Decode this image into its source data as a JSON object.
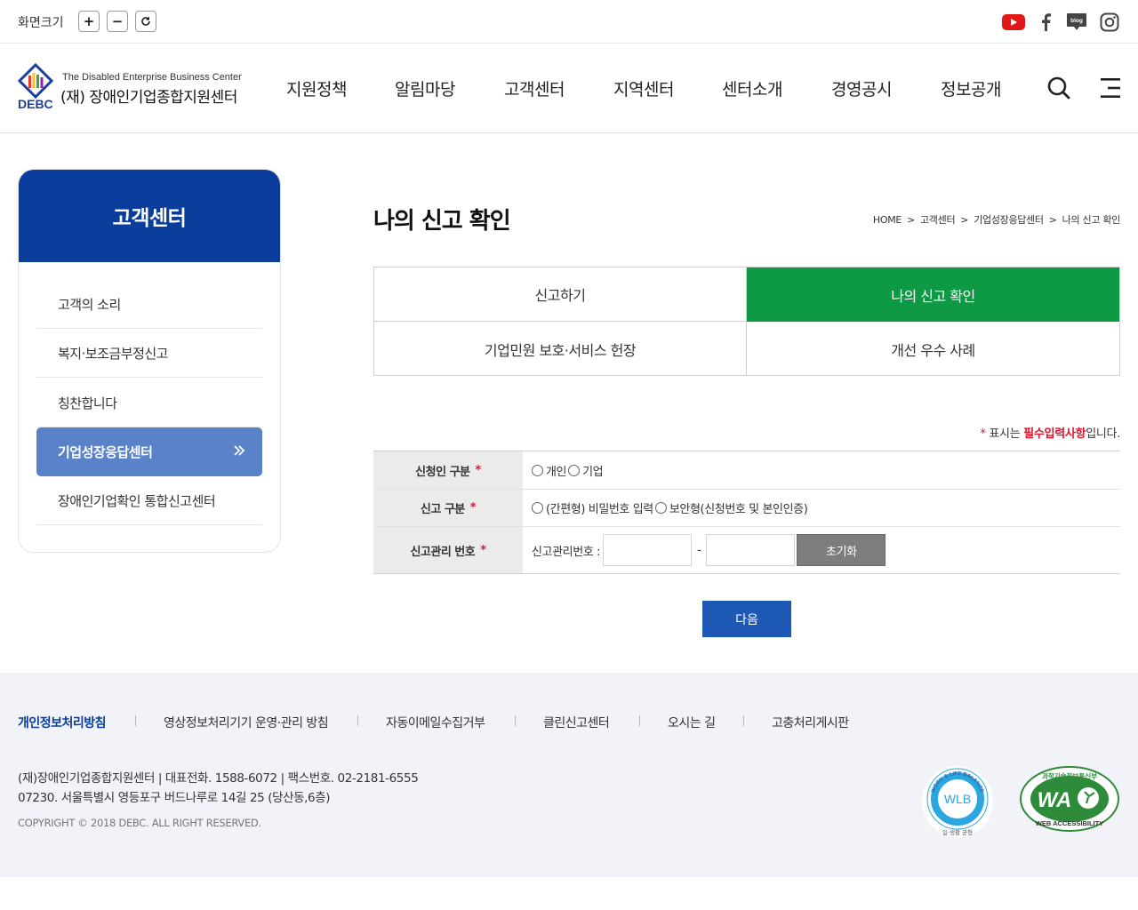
{
  "utility": {
    "screen_size_label": "화면크기",
    "zoom_in": "+",
    "zoom_out": "−",
    "reset_icon": "refresh-icon",
    "social_icons": [
      "youtube-icon",
      "facebook-icon",
      "blog-icon",
      "instagram-icon"
    ]
  },
  "header": {
    "logo_en": "The Disabled Enterprise Business Center",
    "logo_ko": "(재) 장애인기업종합지원센터",
    "logo_abbr": "DEBC",
    "nav": [
      "지원정책",
      "알림마당",
      "고객센터",
      "지역센터",
      "센터소개",
      "경영공시",
      "정보공개"
    ],
    "search_icon": "search-icon",
    "menu_icon": "menu-icon"
  },
  "sidebar": {
    "title": "고객센터",
    "items": [
      "고객의 소리",
      "복지·보조금부정신고",
      "칭찬합니다",
      "기업성장응답센터",
      "장애인기업확인 통합신고센터"
    ],
    "active_index": 3
  },
  "main": {
    "title": "나의 신고 확인",
    "breadcrumb": [
      "HOME",
      "고객센터",
      "기업성장응답센터",
      "나의 신고 확인"
    ],
    "breadcrumb_sep": ">",
    "tabs": [
      "신고하기",
      "나의 신고 확인",
      "기업민원 보호·서비스 헌장",
      "개선 우수 사례"
    ],
    "active_tab": 1,
    "required_note": {
      "star": "*",
      "prefix": " 표시는 ",
      "strong": "필수입력사항",
      "suffix": "입니다."
    },
    "form": {
      "applicant_label": "신청인 구분",
      "applicant_options": [
        "개인",
        "기업"
      ],
      "report_type_label": "신고 구분",
      "report_type_options": [
        "(간편형) 비밀번호 입력",
        "보안형(신청번호 및 본인인증)"
      ],
      "report_no_label": "신고관리 번호",
      "report_no_prefix": "신고관리번호 :",
      "report_no_sep": "-",
      "report_no_value_1": "",
      "report_no_value_2": "",
      "reset_button": "초기화",
      "required_mark": "*"
    },
    "next_button": "다음"
  },
  "footer": {
    "links": [
      "개인정보처리방침",
      "영상정보처리기기 운영·관리 방침",
      "자동이메일수집거부",
      "클린신고센터",
      "오시는 길",
      "고충처리게시판"
    ],
    "info_line1": "(재)장애인기업종합지원센터 | 대표전화. 1588-6072 | 팩스번호. 02-2181-6555",
    "info_line2": "07230. 서울특별시 영등포구 버드나루로 14길 25 (당산동,6층)",
    "copyright": "COPYRIGHT © 2018 DEBC. ALL RIGHT RESERVED.",
    "wlb_badge": {
      "top": "WORK & LIFE BALANCE",
      "center": "WLB",
      "bottom": "일·생활 균형"
    },
    "wa_badge": {
      "top": "과학기술정보통신부",
      "center": "WA",
      "bottom": "WEB ACCESSIBILITY"
    }
  },
  "colors": {
    "brand_blue": "#0a3d9c",
    "active_green": "#0e9a44",
    "sidebar_active": "#5a82c9",
    "required_red": "#e0142a",
    "next_button": "#1e58b5"
  }
}
